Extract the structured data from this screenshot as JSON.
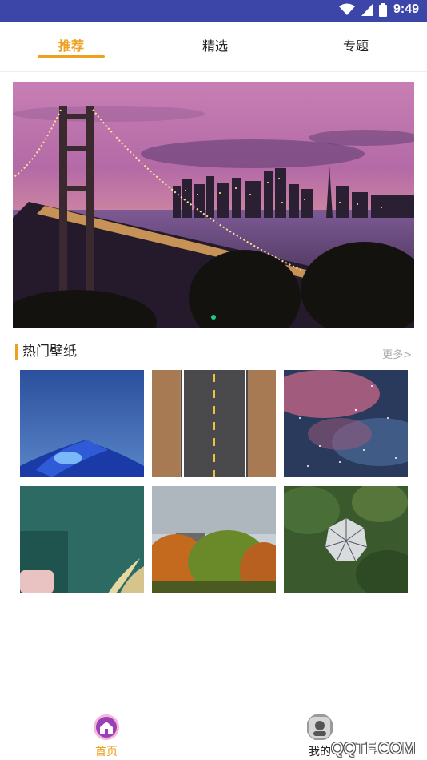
{
  "status_bar": {
    "time": "9:49",
    "icons": [
      "wifi-icon",
      "signal-icon",
      "battery-icon"
    ]
  },
  "tabs": [
    {
      "label": "推荐",
      "active": true
    },
    {
      "label": "精选",
      "active": false
    },
    {
      "label": "专题",
      "active": false
    }
  ],
  "banner": {
    "image": "city-bridge-sunset-image",
    "page_indicator": {
      "current": 1
    }
  },
  "section": {
    "title": "热门壁纸",
    "more": "更多>"
  },
  "wallpapers": [
    "tent-night-image",
    "road-image",
    "nebula-image",
    "teal-bedroom-image",
    "autumn-trees-image",
    "forest-aerial-image"
  ],
  "bottom_nav": [
    {
      "label": "首页",
      "icon": "home-icon",
      "active": true
    },
    {
      "label": "我的",
      "icon": "profile-icon",
      "active": false
    }
  ],
  "watermark": "QQTF.COM",
  "colors": {
    "status_bar": "#3c45a8",
    "accent": "#f0a020",
    "indicator": "#1ec98f"
  }
}
